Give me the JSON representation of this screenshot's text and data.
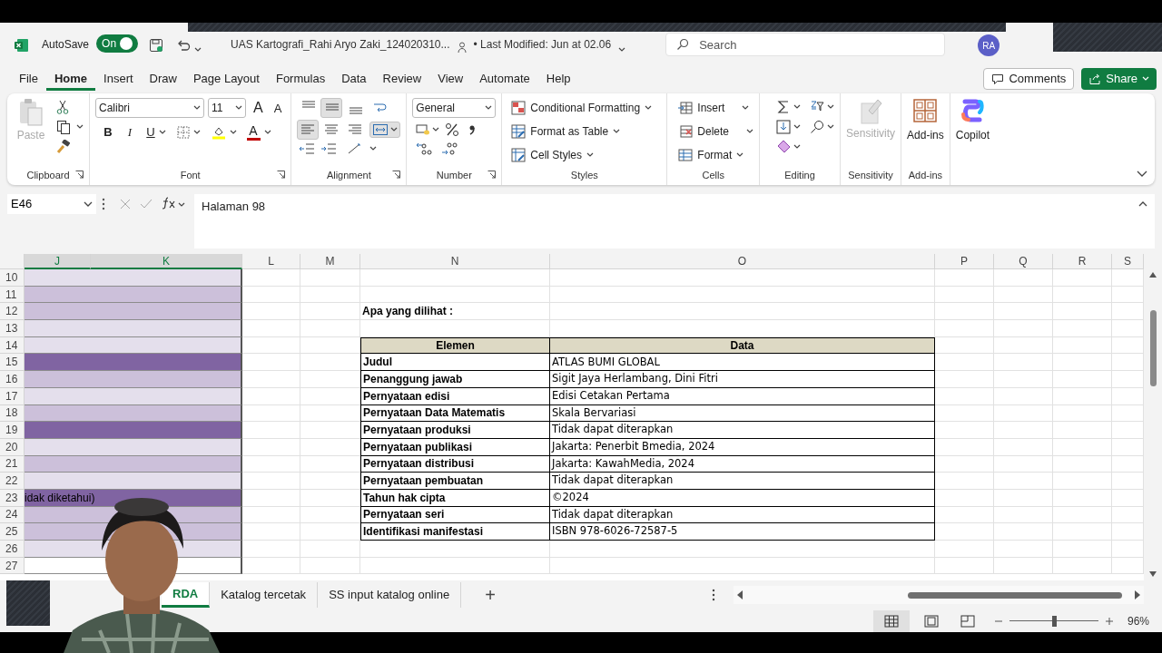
{
  "title_bar": {
    "autosave_label": "AutoSave",
    "toggle": {
      "label": "On",
      "on": true
    },
    "document_title": "UAS Kartografi_Rahi Aryo Zaki_124020310...",
    "last_modified": "• Last Modified: Jun at 02.06",
    "search_placeholder": "Search",
    "avatar": "RA"
  },
  "menu_tabs": [
    {
      "label": "File",
      "selected": false
    },
    {
      "label": "Home",
      "selected": true
    },
    {
      "label": "Insert",
      "selected": false
    },
    {
      "label": "Draw",
      "selected": false
    },
    {
      "label": "Page Layout",
      "selected": false
    },
    {
      "label": "Formulas",
      "selected": false
    },
    {
      "label": "Data",
      "selected": false
    },
    {
      "label": "Review",
      "selected": false
    },
    {
      "label": "View",
      "selected": false
    },
    {
      "label": "Automate",
      "selected": false
    },
    {
      "label": "Help",
      "selected": false
    }
  ],
  "comments_button": "Comments",
  "share_button": "Share",
  "ribbon": {
    "clipboard": {
      "paste": "Paste",
      "paste_disabled": true,
      "label": "Clipboard"
    },
    "font": {
      "family": "Calibri",
      "size": "11",
      "grow": "A",
      "shrink": "A",
      "bold": "B",
      "italic": "I",
      "underline": "U",
      "color_letter": "A",
      "label": "Font"
    },
    "alignment": {
      "label": "Alignment",
      "buttons": [
        {
          "kind": "top",
          "selected": false
        },
        {
          "kind": "middle",
          "selected": true
        },
        {
          "kind": "bottom",
          "selected": false
        },
        {
          "kind": "left",
          "selected": true
        },
        {
          "kind": "center",
          "selected": false
        },
        {
          "kind": "right",
          "selected": false
        }
      ],
      "merge_selected": true
    },
    "number": {
      "format": "General",
      "label": "Number"
    },
    "styles": {
      "items": [
        "Conditional Formatting",
        "Format as Table",
        "Cell Styles"
      ],
      "label": "Styles"
    },
    "cells": {
      "items": [
        "Insert",
        "Delete",
        "Format"
      ],
      "label": "Cells"
    },
    "editing": {
      "label": "Editing"
    },
    "sensitivity": {
      "button": "Sensitivity",
      "disabled": true,
      "label": "Sensitivity"
    },
    "addins": {
      "button": "Add-ins",
      "label": "Add-ins"
    },
    "copilot": {
      "button": "Copilot"
    }
  },
  "formula_bar": {
    "name_box": "E46",
    "formula": "Halaman 98"
  },
  "sheet": {
    "columns": [
      {
        "label": "J",
        "selected": true
      },
      {
        "label": "K",
        "selected": true
      },
      {
        "label": "L",
        "selected": false
      },
      {
        "label": "M",
        "selected": false
      },
      {
        "label": "N",
        "selected": false
      },
      {
        "label": "O",
        "selected": false
      },
      {
        "label": "P",
        "selected": false
      },
      {
        "label": "Q",
        "selected": false
      },
      {
        "label": "R",
        "selected": false
      },
      {
        "label": "S",
        "selected": false
      }
    ],
    "rows": [
      {
        "number": "10",
        "color": "#e4dfec",
        "kind": "blank"
      },
      {
        "number": "11",
        "color": "#ccc0da",
        "kind": "blank"
      },
      {
        "number": "12",
        "color": "#ccc0da",
        "kind": "caption",
        "text": "Apa yang dilihat :"
      },
      {
        "number": "13",
        "color": "#e4dfec",
        "kind": "blank"
      },
      {
        "number": "14",
        "color": "#e4dfec",
        "kind": "table_head",
        "element": "Elemen",
        "data": "Data"
      },
      {
        "number": "15",
        "color": "#8064a2",
        "kind": "table_row",
        "element": "Judul",
        "data": "ATLAS BUMI GLOBAL"
      },
      {
        "number": "16",
        "color": "#ccc0da",
        "kind": "table_row",
        "element": "Penanggung jawab",
        "data": "Sigit Jaya Herlambang, Dini Fitri"
      },
      {
        "number": "17",
        "color": "#e4dfec",
        "kind": "table_row",
        "element": "Pernyataan edisi",
        "data": "Edisi Cetakan Pertama"
      },
      {
        "number": "18",
        "color": "#ccc0da",
        "kind": "table_row",
        "element": "Pernyataan Data Matematis",
        "data": "Skala Bervariasi"
      },
      {
        "number": "19",
        "color": "#8064a2",
        "kind": "table_row",
        "element": "Pernyataan produksi",
        "data": "Tidak dapat diterapkan"
      },
      {
        "number": "20",
        "color": "#e4dfec",
        "kind": "table_row",
        "element": "Pernyataan publikasi",
        "data": "Jakarta: Penerbit Bmedia, 2024"
      },
      {
        "number": "21",
        "color": "#ccc0da",
        "kind": "table_row",
        "element": "Pernyataan distribusi",
        "data": "Jakarta: KawahMedia, 2024"
      },
      {
        "number": "22",
        "color": "#e4dfec",
        "kind": "table_row",
        "element": "Pernyataan pembuatan",
        "data": "Tidak dapat diterapkan"
      },
      {
        "number": "23",
        "color": "#8064a2",
        "kind": "table_row",
        "band_text": "idak diketahui)",
        "element": "Tahun hak cipta",
        "data": "©2024"
      },
      {
        "number": "24",
        "color": "#ccc0da",
        "kind": "table_row",
        "element": "Pernyataan seri",
        "data": "Tidak dapat diterapkan"
      },
      {
        "number": "25",
        "color": "#ccc0da",
        "kind": "table_row",
        "element": "Identifikasi manifestasi",
        "data": "ISBN 978-6026-72587-5"
      },
      {
        "number": "26",
        "color": "#e4dfec",
        "kind": "blank"
      },
      {
        "number": "27",
        "color": "#ffffff",
        "kind": "blank"
      }
    ]
  },
  "sheet_tabs": [
    {
      "label": "RDA",
      "selected": true
    },
    {
      "label": "Katalog tercetak",
      "selected": false
    },
    {
      "label": "SS input katalog online",
      "selected": false
    }
  ],
  "add_sheet": "+",
  "status_bar": {
    "zoom": {
      "level": 0.5
    },
    "zoom_text": "96%"
  }
}
